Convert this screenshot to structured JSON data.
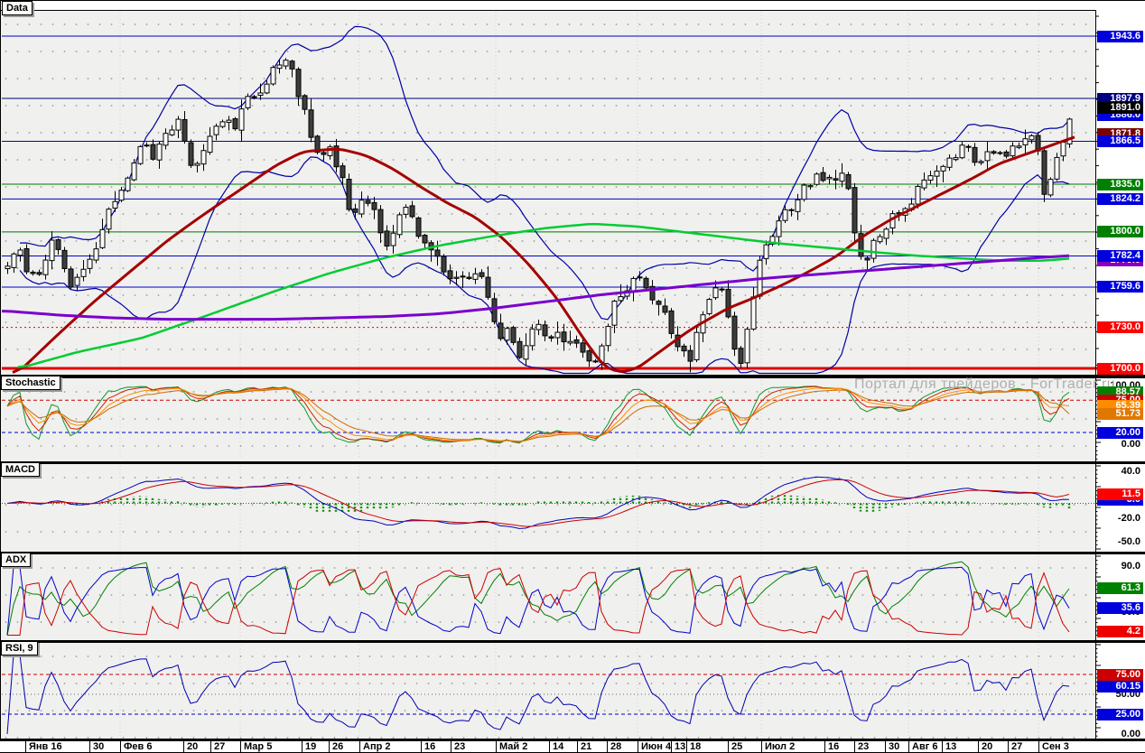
{
  "app": {
    "watermark": "Портал для трейдеров - ForTrader.ru"
  },
  "panels": {
    "data": {
      "label": "Data"
    },
    "stochastic": {
      "label": "Stochastic"
    },
    "macd": {
      "label": "MACD"
    },
    "adx": {
      "label": "ADX"
    },
    "rsi": {
      "label": "RSI, 9"
    }
  },
  "price_axis": {
    "main": [
      {
        "text": "1943.6",
        "bg": "#0000dd",
        "line": {
          "color": "#0000cc",
          "w": 1
        }
      },
      {
        "text": "1897.9",
        "bg": "#000080",
        "line": {
          "color": "#000077",
          "w": 1
        }
      },
      {
        "text": "1886.0",
        "bg": "#0000dd"
      },
      {
        "text": "1891.0",
        "bg": "#000000"
      },
      {
        "text": "1871.8",
        "bg": "#7a0000"
      },
      {
        "text": "1866.5",
        "bg": "#0000dd",
        "line": {
          "color": "#0000cc",
          "w": 1
        }
      },
      {
        "text": "1835.0",
        "bg": "#008000",
        "line": {
          "color": "#007700",
          "w": 1
        }
      },
      {
        "text": "1824.2",
        "bg": "#0000dd",
        "line": {
          "color": "#0000cc",
          "w": 1
        }
      },
      {
        "text": "1800.0",
        "bg": "#008000",
        "line": {
          "color": "#007700",
          "w": 1
        }
      },
      {
        "text": "1779.0",
        "bg": "#8800bb"
      },
      {
        "text": "1782.4",
        "bg": "#0000dd",
        "line": {
          "color": "#0000cc",
          "w": 1
        }
      },
      {
        "text": "1759.6",
        "bg": "#0000dd",
        "line": {
          "color": "#0000cc",
          "w": 1
        }
      },
      {
        "text": "1730.0",
        "bg": "#ff0000",
        "line": {
          "color": "#ee0000",
          "w": 1,
          "dash": "2,3"
        }
      },
      {
        "text": "1700.0",
        "bg": "#ff0000",
        "line": {
          "color": "#dd0000",
          "w": 3
        }
      }
    ],
    "stochastic": [
      {
        "text": "100.00",
        "plain": true
      },
      {
        "text": "88.57",
        "bg": "#008000"
      },
      {
        "text": "75.00",
        "bg": "#cc0000",
        "line": {
          "color": "#cc0000",
          "w": 1,
          "dash": "4,3"
        }
      },
      {
        "text": "65.39",
        "bg": "#ff8c00"
      },
      {
        "text": "51.73",
        "bg": "#e07800"
      },
      {
        "text": "20.00",
        "bg": "#0000dd",
        "line": {
          "color": "#0000cc",
          "w": 1,
          "dash": "4,3"
        }
      },
      {
        "text": "0.00",
        "plain": true
      }
    ],
    "macd": [
      {
        "text": "40.0",
        "plain": true
      },
      {
        "text": "5.0",
        "bg": "#0000dd"
      },
      {
        "text": "11.5",
        "bg": "#ff0000"
      },
      {
        "text": "-20.0",
        "plain": true
      },
      {
        "text": "-50.0",
        "plain": true
      }
    ],
    "adx": [
      {
        "text": "90.0",
        "plain": true
      },
      {
        "text": "30.0",
        "plain": true
      },
      {
        "text": "61.3",
        "bg": "#008000"
      },
      {
        "text": "35.6",
        "bg": "#0000dd"
      },
      {
        "text": "4.2",
        "bg": "#ee0000"
      }
    ],
    "rsi": [
      {
        "text": "75.00",
        "bg": "#cc0000",
        "line": {
          "color": "#cc0000",
          "w": 1,
          "dash": "4,3"
        }
      },
      {
        "text": "50.00",
        "plain": true
      },
      {
        "text": "60.15",
        "bg": "#0000dd"
      },
      {
        "text": "25.00",
        "bg": "#0000dd",
        "line": {
          "color": "#0000cc",
          "w": 1,
          "dash": "4,3"
        }
      },
      {
        "text": "0.00",
        "plain": true
      }
    ]
  },
  "time_axis": {
    "labels": [
      [
        "Янв 16",
        28
      ],
      [
        "30",
        99
      ],
      [
        "Фев 6",
        133
      ],
      [
        "20",
        203
      ],
      [
        "27",
        233
      ],
      [
        "Мар 5",
        266
      ],
      [
        "19",
        334
      ],
      [
        "26",
        364
      ],
      [
        "Апр 2",
        398
      ],
      [
        "16",
        466
      ],
      [
        "23",
        499
      ],
      [
        "Май 2",
        549
      ],
      [
        "14",
        608
      ],
      [
        "21",
        639
      ],
      [
        "28",
        672
      ],
      [
        "Июн 4",
        706
      ],
      [
        "13",
        743
      ],
      [
        "18",
        760
      ],
      [
        "25",
        806
      ],
      [
        "Июл 2",
        843
      ],
      [
        "16",
        913
      ],
      [
        "23",
        946
      ],
      [
        "30",
        980
      ],
      [
        "Авг 6",
        1006
      ],
      [
        "13",
        1043
      ],
      [
        "20",
        1083
      ],
      [
        "27",
        1116
      ],
      [
        "Сен 3",
        1150
      ]
    ],
    "month_x": [
      133,
      266,
      398,
      549,
      706,
      843,
      1006,
      1150
    ]
  },
  "chart_data": [
    {
      "type": "candlestick",
      "panel": "data",
      "ylim": [
        1690,
        1955
      ],
      "last_price": 1891.0,
      "close_keyframes": [
        [
          8,
          1778
        ],
        [
          18,
          1790
        ],
        [
          28,
          1775
        ],
        [
          38,
          1764
        ],
        [
          48,
          1780
        ],
        [
          58,
          1795
        ],
        [
          68,
          1780
        ],
        [
          78,
          1762
        ],
        [
          88,
          1772
        ],
        [
          98,
          1780
        ],
        [
          108,
          1792
        ],
        [
          118,
          1812
        ],
        [
          128,
          1825
        ],
        [
          138,
          1840
        ],
        [
          148,
          1852
        ],
        [
          158,
          1862
        ],
        [
          168,
          1856
        ],
        [
          178,
          1868
        ],
        [
          188,
          1878
        ],
        [
          198,
          1880
        ],
        [
          206,
          1858
        ],
        [
          213,
          1846
        ],
        [
          221,
          1858
        ],
        [
          230,
          1868
        ],
        [
          240,
          1878
        ],
        [
          250,
          1886
        ],
        [
          258,
          1876
        ],
        [
          266,
          1886
        ],
        [
          275,
          1896
        ],
        [
          285,
          1899
        ],
        [
          295,
          1912
        ],
        [
          305,
          1921
        ],
        [
          312,
          1931
        ],
        [
          318,
          1922
        ],
        [
          326,
          1912
        ],
        [
          334,
          1893
        ],
        [
          342,
          1875
        ],
        [
          350,
          1862
        ],
        [
          358,
          1855
        ],
        [
          366,
          1862
        ],
        [
          374,
          1848
        ],
        [
          382,
          1830
        ],
        [
          390,
          1808
        ],
        [
          398,
          1818
        ],
        [
          406,
          1822
        ],
        [
          414,
          1812
        ],
        [
          422,
          1800
        ],
        [
          430,
          1792
        ],
        [
          438,
          1810
        ],
        [
          446,
          1820
        ],
        [
          454,
          1810
        ],
        [
          462,
          1800
        ],
        [
          470,
          1792
        ],
        [
          478,
          1782
        ],
        [
          486,
          1780
        ],
        [
          494,
          1772
        ],
        [
          502,
          1765
        ],
        [
          510,
          1762
        ],
        [
          518,
          1768
        ],
        [
          526,
          1772
        ],
        [
          534,
          1770
        ],
        [
          540,
          1748
        ],
        [
          548,
          1730
        ],
        [
          556,
          1720
        ],
        [
          562,
          1736
        ],
        [
          570,
          1712
        ],
        [
          578,
          1704
        ],
        [
          586,
          1722
        ],
        [
          594,
          1732
        ],
        [
          602,
          1728
        ],
        [
          610,
          1722
        ],
        [
          618,
          1728
        ],
        [
          626,
          1722
        ],
        [
          634,
          1716
        ],
        [
          642,
          1712
        ],
        [
          650,
          1708
        ],
        [
          660,
          1704
        ],
        [
          672,
          1730
        ],
        [
          685,
          1755
        ],
        [
          700,
          1765
        ],
        [
          710,
          1770
        ],
        [
          720,
          1754
        ],
        [
          735,
          1740
        ],
        [
          750,
          1715
        ],
        [
          762,
          1704
        ],
        [
          775,
          1735
        ],
        [
          790,
          1760
        ],
        [
          800,
          1754
        ],
        [
          812,
          1715
        ],
        [
          818,
          1700
        ],
        [
          828,
          1736
        ],
        [
          840,
          1775
        ],
        [
          855,
          1800
        ],
        [
          870,
          1815
        ],
        [
          885,
          1826
        ],
        [
          900,
          1838
        ],
        [
          915,
          1842
        ],
        [
          925,
          1834
        ],
        [
          935,
          1846
        ],
        [
          945,
          1800
        ],
        [
          955,
          1778
        ],
        [
          965,
          1788
        ],
        [
          975,
          1800
        ],
        [
          990,
          1812
        ],
        [
          1005,
          1822
        ],
        [
          1020,
          1832
        ],
        [
          1035,
          1842
        ],
        [
          1050,
          1852
        ],
        [
          1065,
          1862
        ],
        [
          1075,
          1857
        ],
        [
          1085,
          1851
        ],
        [
          1095,
          1858
        ],
        [
          1105,
          1862
        ],
        [
          1115,
          1856
        ],
        [
          1125,
          1862
        ],
        [
          1135,
          1866
        ],
        [
          1145,
          1870
        ],
        [
          1152,
          1844
        ],
        [
          1158,
          1820
        ],
        [
          1164,
          1838
        ],
        [
          1172,
          1855
        ],
        [
          1180,
          1874
        ],
        [
          1190,
          1891
        ]
      ],
      "bollinger": {
        "window": 18,
        "mult": 2,
        "color": "#0000a6",
        "width": 1.2
      },
      "ma_lines": [
        {
          "name": "ma-red-line",
          "color": "#a40000",
          "width": 3,
          "points": [
            [
              14,
              1697
            ],
            [
              60,
              1726
            ],
            [
              100,
              1750
            ],
            [
              140,
              1772
            ],
            [
              180,
              1794
            ],
            [
              220,
              1813
            ],
            [
              260,
              1831
            ],
            [
              300,
              1849
            ],
            [
              330,
              1859
            ],
            [
              370,
              1861
            ],
            [
              400,
              1856
            ],
            [
              430,
              1846
            ],
            [
              460,
              1833
            ],
            [
              490,
              1821
            ],
            [
              520,
              1811
            ],
            [
              550,
              1796
            ],
            [
              580,
              1776
            ],
            [
              610,
              1752
            ],
            [
              640,
              1722
            ],
            [
              662,
              1702
            ],
            [
              680,
              1697
            ],
            [
              700,
              1700
            ],
            [
              720,
              1710
            ],
            [
              760,
              1729
            ],
            [
              800,
              1744
            ],
            [
              830,
              1752
            ],
            [
              860,
              1761
            ],
            [
              890,
              1771
            ],
            [
              920,
              1782
            ],
            [
              950,
              1797
            ],
            [
              980,
              1809
            ],
            [
              1010,
              1819
            ],
            [
              1040,
              1829
            ],
            [
              1070,
              1839
            ],
            [
              1100,
              1850
            ],
            [
              1130,
              1857
            ],
            [
              1160,
              1864
            ],
            [
              1190,
              1871
            ]
          ]
        },
        {
          "name": "ma-green-line",
          "color": "#00cc33",
          "width": 2.5,
          "points": [
            [
              20,
              1701
            ],
            [
              80,
              1712
            ],
            [
              150,
              1722
            ],
            [
              220,
              1738
            ],
            [
              300,
              1757
            ],
            [
              360,
              1770
            ],
            [
              420,
              1781
            ],
            [
              480,
              1790
            ],
            [
              540,
              1797
            ],
            [
              600,
              1803
            ],
            [
              650,
              1806
            ],
            [
              700,
              1804
            ],
            [
              750,
              1800
            ],
            [
              800,
              1796
            ],
            [
              850,
              1792
            ],
            [
              900,
              1789
            ],
            [
              950,
              1786
            ],
            [
              1000,
              1783
            ],
            [
              1050,
              1781
            ],
            [
              1100,
              1779
            ],
            [
              1150,
              1779
            ],
            [
              1188,
              1781
            ]
          ]
        },
        {
          "name": "ma-purple-line",
          "color": "#7a00cc",
          "width": 3,
          "points": [
            [
              2,
              1742
            ],
            [
              60,
              1739
            ],
            [
              120,
              1737
            ],
            [
              180,
              1736
            ],
            [
              240,
              1736
            ],
            [
              300,
              1736
            ],
            [
              360,
              1737
            ],
            [
              420,
              1738
            ],
            [
              480,
              1740
            ],
            [
              540,
              1744
            ],
            [
              600,
              1749
            ],
            [
              660,
              1754
            ],
            [
              720,
              1758
            ],
            [
              780,
              1762
            ],
            [
              840,
              1766
            ],
            [
              900,
              1769
            ],
            [
              960,
              1772
            ],
            [
              1020,
              1775
            ],
            [
              1080,
              1778
            ],
            [
              1140,
              1781
            ],
            [
              1188,
              1783
            ]
          ]
        }
      ]
    },
    {
      "type": "line",
      "panel": "stochastic",
      "ylim": [
        0,
        100
      ],
      "window": 22,
      "lines": [
        {
          "name": "stoch-k-line",
          "color": "#089b2a",
          "period": 2,
          "end": 88.57
        },
        {
          "name": "stoch-d1-line",
          "color": "#cc2200",
          "period": 4,
          "end": 78.0
        },
        {
          "name": "stoch-d2-line",
          "color": "#ff8c00",
          "period": 7,
          "end": 65.39
        },
        {
          "name": "stoch-d3-line",
          "color": "#cc6a00",
          "period": 11,
          "end": 51.73
        }
      ]
    },
    {
      "type": "macd",
      "panel": "macd",
      "ylim": [
        -55,
        42
      ],
      "fast": 9,
      "slow": 20,
      "signal_period": 7,
      "gain": 1.25,
      "line_color": "#0000bb",
      "signal_color": "#cc0000",
      "hist_color": "#0b8a0b",
      "end": {
        "macd": 5.0,
        "signal": 11.5
      },
      "zero_level": {
        "v": 0,
        "color": "#555555",
        "dash": "1,2"
      }
    },
    {
      "type": "adx",
      "panel": "adx",
      "ylim": [
        0,
        95
      ],
      "lines": [
        {
          "name": "adx-line",
          "color": "#008000",
          "end": 61.3
        },
        {
          "name": "di-plus-line",
          "color": "#0000cc",
          "end": 35.6
        },
        {
          "name": "di-minus-line",
          "color": "#cc0000",
          "end": 4.2
        }
      ]
    },
    {
      "type": "rsi",
      "panel": "rsi",
      "period": 9,
      "ylim": [
        0,
        100
      ],
      "color": "#0000b0",
      "end": 60.15,
      "mid_level": {
        "v": 50,
        "color": "#666666",
        "dash": "1,3"
      }
    }
  ]
}
